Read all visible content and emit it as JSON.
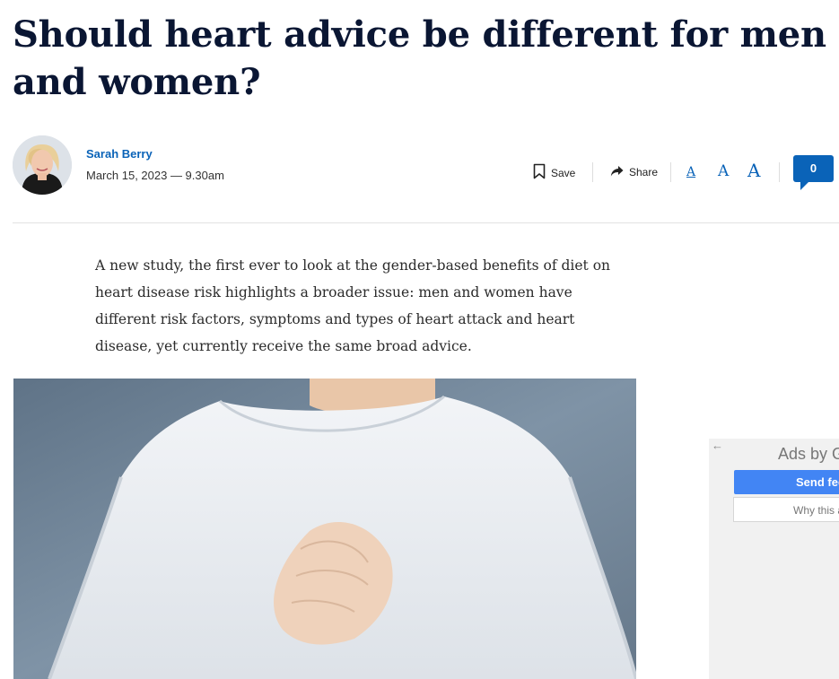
{
  "article": {
    "headline": "Should heart advice be different for men and women?",
    "author": "Sarah Berry",
    "date": "March 15, 2023 — 9.30am",
    "intro": "A new study, the first ever to look at the gender-based benefits of diet on heart disease risk highlights a broader issue: men and women have different risk factors, symptoms and types of heart attack and heart disease, yet currently receive the same broad advice."
  },
  "toolbar": {
    "save_label": "Save",
    "share_label": "Share",
    "text_small": "A",
    "text_medium": "A",
    "text_large": "A",
    "comment_count": "0",
    "icons": [
      "bookmark-icon",
      "share-arrow-icon"
    ]
  },
  "ad": {
    "back_glyph": "←",
    "ads_by": "Ads by G",
    "send_feedback": "Send feedback",
    "why_this": "Why this ad?"
  },
  "colors": {
    "headline": "#0a1633",
    "accent": "#0a63b8",
    "ad_button": "#4285f4"
  }
}
